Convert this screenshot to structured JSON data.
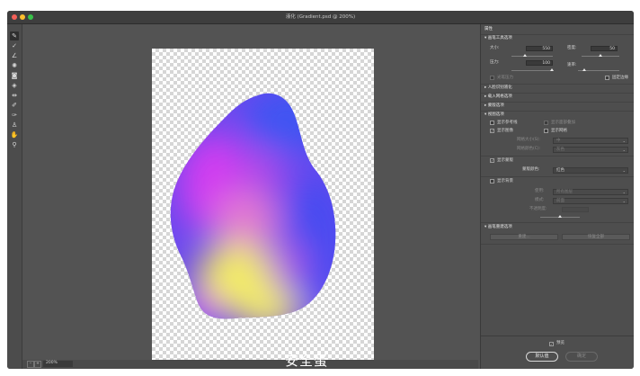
{
  "window": {
    "title": "液化 (Gradient.psd @ 200%)",
    "traffic_lights": [
      "#f25f58",
      "#fbbe2e",
      "#38c149"
    ]
  },
  "tools": [
    {
      "icon": "forward-warp-tool-icon",
      "glyph": "✎",
      "selected": true
    },
    {
      "icon": "reconstruct-tool-icon",
      "glyph": "✓"
    },
    {
      "icon": "smooth-tool-icon",
      "glyph": "∠"
    },
    {
      "icon": "twirl-clockwise-tool-icon",
      "glyph": "✺"
    },
    {
      "icon": "pucker-tool-icon",
      "glyph": "◙"
    },
    {
      "icon": "bloat-tool-icon",
      "glyph": "◈"
    },
    {
      "icon": "push-left-tool-icon",
      "glyph": "⇹"
    },
    {
      "icon": "freeze-mask-tool-icon",
      "glyph": "✐"
    },
    {
      "icon": "thaw-mask-tool-icon",
      "glyph": "✑"
    },
    {
      "icon": "face-tool-icon",
      "glyph": "♙"
    },
    {
      "icon": "hand-tool-icon",
      "glyph": "✋"
    },
    {
      "icon": "zoom-tool-icon",
      "glyph": "⚲"
    }
  ],
  "canvas": {
    "blob_gradient": {
      "magenta": "#c93cf0",
      "blue": "#4b4ff0",
      "yellow": "#f3ee63",
      "pink": "#e678c0"
    }
  },
  "statusbar": {
    "zoom_value": "200%",
    "zoom_minus": "–",
    "zoom_plus": "+"
  },
  "watermark": "安全蛋",
  "panel": {
    "header": "属性",
    "brush_section": {
      "title": "画笔工具选项",
      "size_label": "大小:",
      "size_value": "550",
      "density_label": "密度:",
      "density_value": "50",
      "pressure_label": "压力:",
      "pressure_value": "100",
      "rate_label": "速率:",
      "stylus_label": "光笔压力",
      "pin_edges_label": "固定边缘"
    },
    "collapsed_sections": [
      "人脸识别液化",
      "载入网格选项",
      "蒙版选项"
    ],
    "view_section": {
      "title": "视图选项",
      "show_guides": "显示参考线",
      "show_face_overlay": "显示面部叠加",
      "show_image": "显示图像",
      "show_mesh": "显示网格",
      "mesh_size_label": "网格大小(S):",
      "mesh_size_value": "中",
      "mesh_color_label": "网格颜色(C):",
      "mesh_color_value": "灰色",
      "show_mask": "显示蒙版",
      "mask_color_label": "蒙版颜色:",
      "mask_color_value": "红色",
      "show_backdrop": "显示背景",
      "use_label": "使用:",
      "use_value": "所有图层",
      "mode_label": "模式:",
      "mode_value": "前面",
      "opacity_label": "不透明度:"
    },
    "reconstruct_section": {
      "title": "画笔重建选项",
      "reconstruct_btn": "重建...",
      "restore_all_btn": "恢复全部"
    },
    "preview_label": "预览",
    "default_btn": "默认值",
    "ok_btn": "确定"
  }
}
